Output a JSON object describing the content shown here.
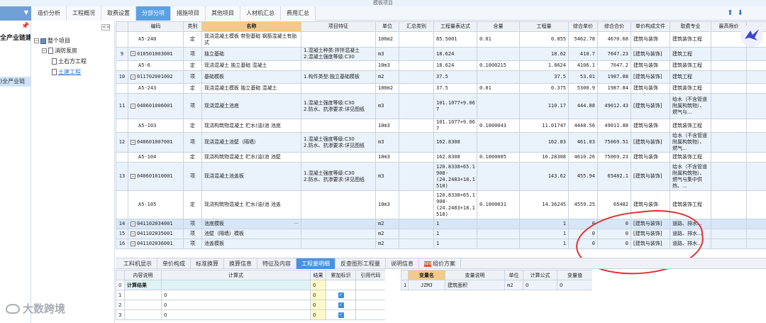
{
  "window": {
    "title": "模板项目"
  },
  "top_tabs": [
    "造价分析",
    "工程概况",
    "取费设置",
    "分部分项",
    "措施项目",
    "其他项目",
    "人材机汇总",
    "费用汇总"
  ],
  "left_pane": {
    "line1": "全产业链建",
    "line2": ")全产业链"
  },
  "tree": {
    "collapse_label": "<<",
    "root": "整个项目",
    "child": "消防泵房",
    "leaf1": "土石方工程",
    "leaf2": "土建工程"
  },
  "columns": [
    "编码",
    "类别",
    "名称",
    "项目特征",
    "单位",
    "汇总类别",
    "工程量表达式",
    "含量",
    "工程量",
    "综合单价",
    "综合合价",
    "单价构成文件",
    "取费专业",
    "最高限价"
  ],
  "rows": [
    {
      "no": "",
      "code": "A5-240",
      "type": "定",
      "name": "现浇混凝土模板 带型基础 钢筋混凝土有肋式",
      "feature": "",
      "unit": "100m2",
      "sum_cat": "",
      "expr": "85.5001",
      "content": "0.01",
      "qty": "0.855",
      "price": "5462.78",
      "total": "4670.68",
      "file": "建筑与装饰",
      "prof": "建筑装饰工程",
      "kind": "de"
    },
    {
      "no": "9",
      "code": "010501003001",
      "type": "项",
      "name": "独立基础",
      "feature": "1.混凝土种类:拌拌混凝土\n2.混凝土强度等级:C30",
      "unit": "m3",
      "sum_cat": "",
      "expr": "18.624",
      "content": "",
      "qty": "18.62",
      "price": "410.7",
      "total": "7647.23",
      "file": "[建筑与装饰]",
      "prof": "建筑工程",
      "kind": "qd"
    },
    {
      "no": "",
      "code": "A5-6",
      "type": "定",
      "name": "现浇混凝土 独立基础 混凝土",
      "feature": "",
      "unit": "10m3",
      "sum_cat": "",
      "expr": "18.624",
      "content": "0.1000215",
      "qty": "1.8624",
      "price": "4106.1",
      "total": "7647.2",
      "file": "建筑与装饰",
      "prof": "建筑装饰工程",
      "kind": "de"
    },
    {
      "no": "10",
      "code": "011702001002",
      "type": "项",
      "name": "基础模板",
      "feature": "1.构件类型:独立基础模板",
      "unit": "m2",
      "sum_cat": "",
      "expr": "37.5",
      "content": "",
      "qty": "37.5",
      "price": "53.01",
      "total": "1987.88",
      "file": "[建筑与装饰]",
      "prof": "建筑工程",
      "kind": "qd"
    },
    {
      "no": "",
      "code": "A5-243",
      "type": "定",
      "name": "现浇混凝土模板 独立基础 混凝土",
      "feature": "",
      "unit": "100m2",
      "sum_cat": "",
      "expr": "37.5",
      "content": "0.01",
      "qty": "0.375",
      "price": "5300.9",
      "total": "1987.84",
      "file": "建筑与装饰",
      "prof": "建筑装饰工程",
      "kind": "de"
    },
    {
      "no": "11",
      "code": "040601006001",
      "type": "项",
      "name": "现浇混凝土池底",
      "feature": "1.混凝土强度等级:C30\n2.防水、抗渗要求:详见图纸",
      "unit": "m3",
      "sum_cat": "",
      "expr": "101.1077+9.06\n7",
      "content": "",
      "qty": "110.17",
      "price": "444.88",
      "total": "49012.43",
      "file": "[建筑与装饰]",
      "prof": "给水（不含管道附属构筑物）、燃气与...",
      "kind": "qd"
    },
    {
      "no": "",
      "code": "A5-103",
      "type": "定",
      "name": "现浇构筑物混凝土 贮水(油)池 池底",
      "feature": "",
      "unit": "10m3",
      "sum_cat": "",
      "expr": "101.1077+9.06\n7",
      "content": "0.1000043",
      "qty": "11.01747",
      "price": "4448.56",
      "total": "49011.88",
      "file": "建筑与装饰",
      "prof": "建筑装饰工程",
      "kind": "de"
    },
    {
      "no": "12",
      "code": "040601007001",
      "type": "项",
      "name": "现浇混凝土池壁（隔墙）",
      "feature": "1.混凝土强度等级:C30\n2.防水、抗渗要求:详见图纸",
      "unit": "m3",
      "sum_cat": "",
      "expr": "162.8308",
      "content": "",
      "qty": "162.83",
      "price": "461.03",
      "total": "75069.51",
      "file": "[建筑与装饰]",
      "prof": "给水（不含管道附属构筑物）、燃气...",
      "kind": "qd"
    },
    {
      "no": "",
      "code": "A5-104",
      "type": "定",
      "name": "现浇构筑物混凝土 贮水(油)池 池壁",
      "feature": "",
      "unit": "10m3",
      "sum_cat": "",
      "expr": "162.8308",
      "content": "0.1000005",
      "qty": "16.28308",
      "price": "4610.26",
      "total": "75069.23",
      "file": "建筑与装饰",
      "prof": "建筑装饰工程",
      "kind": "de"
    },
    {
      "no": "13",
      "code": "040601010001",
      "type": "项",
      "name": "现浇混凝土池盖板",
      "feature": "1.混凝土强度等级:C30\n2.防水、抗渗要求:详见图纸",
      "unit": "m3",
      "sum_cat": "",
      "expr": "120.8338+65.1\n908-\n(24.2483+18.1\n518)",
      "content": "",
      "qty": "143.62",
      "price": "455.94",
      "total": "65482.1",
      "file": "[建筑与装饰]",
      "prof": "给水（不含管道附属构筑物）、燃气与集中供热、...",
      "kind": "qd"
    },
    {
      "no": "",
      "code": "A5-105",
      "type": "定",
      "name": "现浇构筑物混凝土 贮水(油)池 池盖",
      "feature": "",
      "unit": "10m3",
      "sum_cat": "",
      "expr": "120.8338+65.1\n908-\n(24.2483+18.1\n518)",
      "content": "0.1000031",
      "qty": "14.36245",
      "price": "4559.25",
      "total": "65482",
      "file": "建筑与装饰",
      "prof": "建筑装饰工程",
      "kind": "de"
    },
    {
      "no": "14",
      "code": "041102034001",
      "type": "项",
      "name": "池底模板",
      "feature": "",
      "unit": "m2",
      "sum_cat": "",
      "expr": "1",
      "content": "",
      "qty": "1",
      "price": "0",
      "total": "0",
      "file": "[建筑与装饰]",
      "prof": "道路、排水...",
      "kind": "sel"
    },
    {
      "no": "15",
      "code": "041102035001",
      "type": "项",
      "name": "池壁（隔墙）模板",
      "feature": "",
      "unit": "m2",
      "sum_cat": "",
      "expr": "1",
      "content": "",
      "qty": "1",
      "price": "0",
      "total": "0",
      "file": "[建筑与装饰]",
      "prof": "道路、排水...",
      "kind": "qd"
    },
    {
      "no": "16",
      "code": "041102036001",
      "type": "项",
      "name": "池盖模板",
      "feature": "",
      "unit": "m2",
      "sum_cat": "",
      "expr": "1",
      "content": "",
      "qty": "1",
      "price": "0",
      "total": "0",
      "file": "[建筑与装饰]",
      "prof": "道路、排水...",
      "kind": "qd"
    }
  ],
  "bottom_tabs": [
    "工料机显示",
    "单价构成",
    "标准换算",
    "换算信息",
    "特征及内容",
    "工程量明细",
    "反查图形工程量",
    "说明信息",
    "组价方案"
  ],
  "bottom_active": "工程量明细",
  "calc_table": {
    "headers": [
      "内容说明",
      "计算式",
      "结果",
      "累加标识",
      "引用代码"
    ],
    "rows": [
      {
        "no": "0",
        "desc": "计算结果",
        "formula": "",
        "result": "0",
        "checked": false
      },
      {
        "no": "1",
        "desc": "",
        "formula": "0",
        "result": "0",
        "checked": true
      },
      {
        "no": "2",
        "desc": "",
        "formula": "0",
        "result": "0",
        "checked": true
      },
      {
        "no": "3",
        "desc": "",
        "formula": "0",
        "result": "0",
        "checked": true
      }
    ]
  },
  "var_table": {
    "headers": [
      "变量名",
      "变量说明",
      "单位",
      "计算公式",
      "变量值"
    ],
    "rows": [
      {
        "no": "1",
        "name": "JZMJ",
        "desc": "建筑面积",
        "unit": "m2",
        "formula": "0",
        "value": "0"
      }
    ]
  },
  "watermark": "大数跨境",
  "colors": {
    "accent": "#5aa0e6",
    "header_highlight": "#f5c98a",
    "annotation_red": "#e03030",
    "check_blue": "#3a8de0"
  }
}
